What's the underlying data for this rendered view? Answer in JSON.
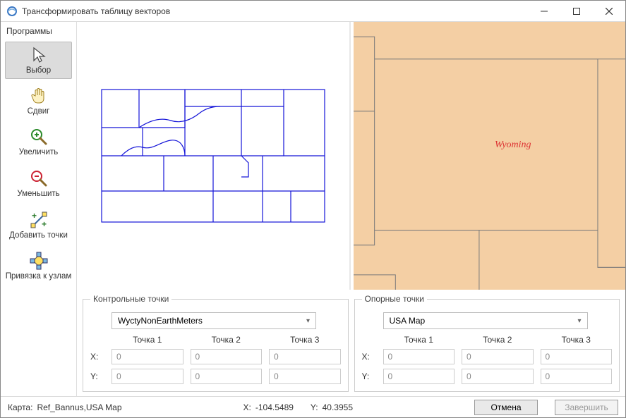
{
  "window": {
    "title": "Трансформировать таблицу векторов"
  },
  "sidebar": {
    "header": "Программы",
    "tools": [
      {
        "id": "select",
        "label": "Выбор"
      },
      {
        "id": "pan",
        "label": "Сдвиг"
      },
      {
        "id": "zoomin",
        "label": "Увеличить"
      },
      {
        "id": "zoomout",
        "label": "Уменьшить"
      },
      {
        "id": "addpts",
        "label": "Добавить точки"
      },
      {
        "id": "snap",
        "label": "Привязка к узлам"
      }
    ]
  },
  "map_right": {
    "region_label": "Wyoming"
  },
  "panels": {
    "left": {
      "legend": "Контрольные точки",
      "dropdown": "WyctyNonEarthMeters",
      "cols": [
        "Точка 1",
        "Точка 2",
        "Точка 3"
      ],
      "rows": {
        "x_label": "X:",
        "y_label": "Y:",
        "x": [
          "0",
          "0",
          "0"
        ],
        "y": [
          "0",
          "0",
          "0"
        ]
      }
    },
    "right": {
      "legend": "Опорные точки",
      "dropdown": "USA Map",
      "cols": [
        "Точка 1",
        "Точка 2",
        "Точка 3"
      ],
      "rows": {
        "x_label": "X:",
        "y_label": "Y:",
        "x": [
          "0",
          "0",
          "0"
        ],
        "y": [
          "0",
          "0",
          "0"
        ]
      }
    }
  },
  "status": {
    "map_label": "Карта:",
    "map_value": "Ref_Bannus,USA Map",
    "x_label": "X:",
    "x_value": "-104.5489",
    "y_label": "Y:",
    "y_value": "40.3955",
    "cancel": "Отмена",
    "finish": "Завершить"
  }
}
